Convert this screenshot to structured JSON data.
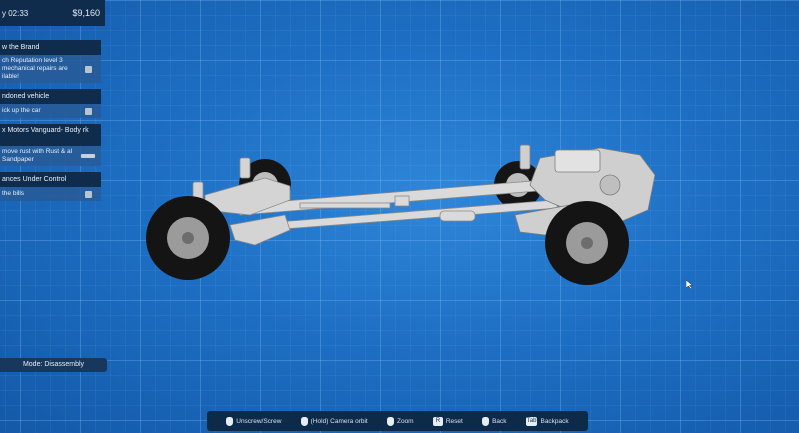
{
  "topbar": {
    "time": "y 02:33",
    "money": "$9,160"
  },
  "tasks": [
    {
      "header": "w the Brand",
      "tall": false,
      "items": [
        {
          "label": "ch Reputation level 3 mechanical repairs are ilable!",
          "control": "check"
        }
      ]
    },
    {
      "header": "ndoned vehicle",
      "tall": false,
      "items": [
        {
          "label": "ick up the car",
          "control": "check"
        }
      ]
    },
    {
      "header": "x Motors Vanguard- Body rk",
      "tall": true,
      "items": [
        {
          "label": "move rust with Rust & al Sandpaper",
          "control": "bar"
        }
      ]
    },
    {
      "header": "ances Under Control",
      "tall": false,
      "items": [
        {
          "label": "the bills",
          "control": "check"
        }
      ]
    }
  ],
  "main_button": "Mode: Disassembly",
  "hints": [
    {
      "icon": "mouse-icon",
      "key": "",
      "label": "Unscrew/Screw"
    },
    {
      "icon": "mouse-icon",
      "key": "",
      "label": "(Hold) Camera orbit"
    },
    {
      "icon": "mouse-icon",
      "key": "",
      "label": "Zoom"
    },
    {
      "icon": "key-icon",
      "key": "R",
      "label": "Reset"
    },
    {
      "icon": "mouse-icon",
      "key": "",
      "label": "Back"
    },
    {
      "icon": "key-icon",
      "key": "Tab",
      "label": "Backpack"
    }
  ],
  "colors": {
    "panel": "#0f2c4d",
    "background": "#1d6fc4",
    "chassis": "#d8d8d8",
    "tire": "#141414"
  }
}
